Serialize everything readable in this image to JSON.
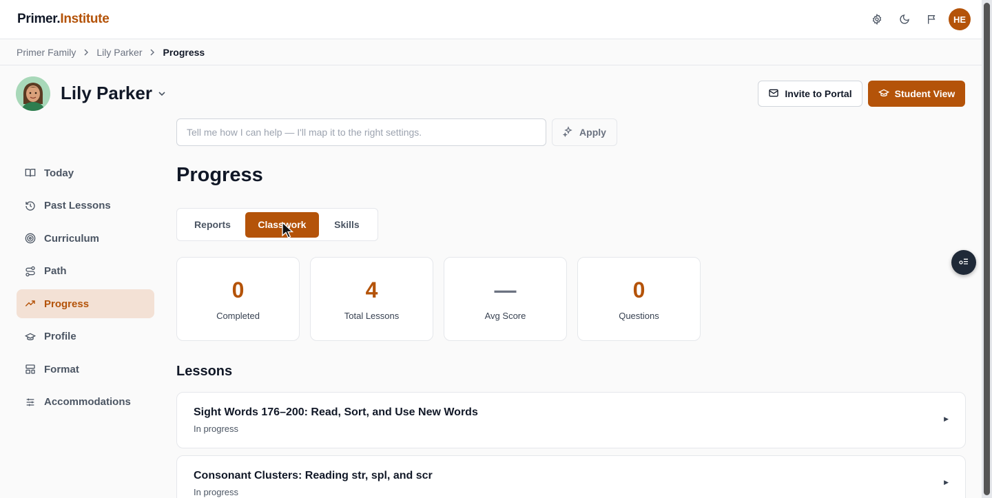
{
  "app": {
    "logo_part1": "Primer.",
    "logo_part2": "Institute",
    "user_initials": "HE",
    "accent_color": "#b45309"
  },
  "topbar": {
    "icons": [
      "gear-icon",
      "moon-icon",
      "flag-icon"
    ]
  },
  "breadcrumb": {
    "items": [
      "Primer Family",
      "Lily Parker"
    ],
    "current": "Progress"
  },
  "student": {
    "name": "Lily Parker",
    "invite_label": "Invite to Portal",
    "student_view_label": "Student View"
  },
  "assistant": {
    "placeholder": "Tell me how I can help — I'll map it to the right settings.",
    "apply_label": "Apply"
  },
  "sidebar": {
    "items": [
      {
        "label": "Today",
        "icon": "book-open-icon"
      },
      {
        "label": "Past Lessons",
        "icon": "history-icon"
      },
      {
        "label": "Curriculum",
        "icon": "target-icon"
      },
      {
        "label": "Path",
        "icon": "route-icon"
      },
      {
        "label": "Progress",
        "icon": "trending-up-icon",
        "active": true
      },
      {
        "label": "Profile",
        "icon": "graduation-cap-icon"
      },
      {
        "label": "Format",
        "icon": "layout-icon"
      },
      {
        "label": "Accommodations",
        "icon": "sliders-icon"
      }
    ]
  },
  "main": {
    "title": "Progress",
    "tabs": [
      {
        "label": "Reports"
      },
      {
        "label": "Classwork",
        "active": true
      },
      {
        "label": "Skills"
      }
    ],
    "stats": [
      {
        "value": "0",
        "label": "Completed"
      },
      {
        "value": "4",
        "label": "Total Lessons"
      },
      {
        "value": "—",
        "label": "Avg Score"
      },
      {
        "value": "0",
        "label": "Questions"
      }
    ],
    "lessons_title": "Lessons",
    "lessons": [
      {
        "title": "Sight Words 176–200: Read, Sort, and Use New Words",
        "status": "In progress"
      },
      {
        "title": "Consonant Clusters: Reading str, spl, and scr",
        "status": "In progress"
      }
    ]
  }
}
